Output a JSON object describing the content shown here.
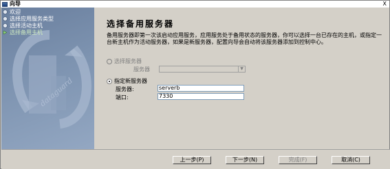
{
  "window": {
    "title": "向导",
    "close_label": "X"
  },
  "steps": [
    {
      "label": "欢迎",
      "current": false
    },
    {
      "label": "选择应用服务类型",
      "current": false
    },
    {
      "label": "选择活动主机",
      "current": false
    },
    {
      "label": "选择备用主机",
      "current": true
    }
  ],
  "page": {
    "heading": "选择备用服务器",
    "description": "备用服务器即第一次该启动应用服务，应用服务处于备用状态的服务器，你可以选择一台已存在的主机，或指定一台新主机作为活动服务器，如果是新服务器，配置向导会自动将该服务器添加到控制中心。"
  },
  "option_existing": {
    "label": "选择服务器",
    "field_label": "服务器",
    "selected_value": ""
  },
  "option_new": {
    "label": "指定新服务器",
    "server_label": "服务器:",
    "server_value": "serverb",
    "port_label": "端口:",
    "port_value": "7330"
  },
  "buttons": {
    "back": "上一步(P)",
    "next": "下一步(N)",
    "finish": "完成(F)",
    "cancel": "取消(C)"
  },
  "colors": {
    "sidebar": "#7d93b0",
    "dialog_bg": "#d4d0c8"
  }
}
